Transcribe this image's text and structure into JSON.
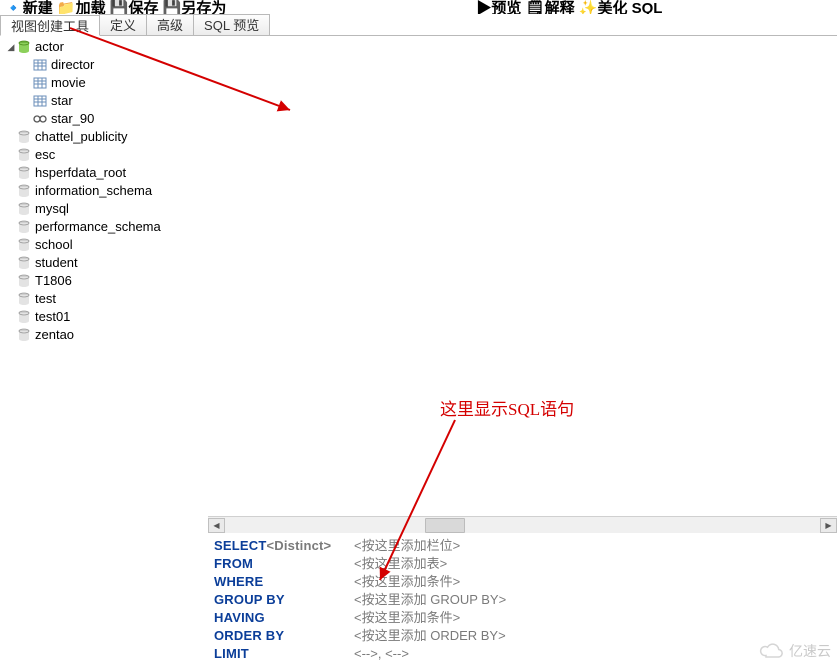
{
  "toolbar": {
    "items": [
      "新建",
      "加载",
      "保存",
      "另存为",
      "预览",
      "解释",
      "美化 SQL"
    ]
  },
  "tabs": [
    {
      "label": "视图创建工具",
      "active": true
    },
    {
      "label": "定义",
      "active": false
    },
    {
      "label": "高级",
      "active": false
    },
    {
      "label": "SQL 预览",
      "active": false
    }
  ],
  "tree": {
    "expanded_db": "actor",
    "actor_children": [
      {
        "label": "director",
        "type": "table"
      },
      {
        "label": "movie",
        "type": "table"
      },
      {
        "label": "star",
        "type": "table"
      },
      {
        "label": "star_90",
        "type": "view"
      }
    ],
    "other_dbs": [
      "chattel_publicity",
      "esc",
      "hsperfdata_root",
      "information_schema",
      "mysql",
      "performance_schema",
      "school",
      "student",
      "T1806",
      "test",
      "test01",
      "zentao"
    ]
  },
  "sql": {
    "select_kw": "SELECT",
    "distinct": "<Distinct>",
    "select_ph": "<按这里添加栏位>",
    "from_kw": "FROM",
    "from_ph": "<按这里添加表>",
    "where_kw": "WHERE",
    "where_ph": "<按这里添加条件>",
    "group_kw": "GROUP BY",
    "group_ph": "<按这里添加 GROUP BY>",
    "having_kw": "HAVING",
    "having_ph": "<按这里添加条件>",
    "order_kw": "ORDER BY",
    "order_ph": "<按这里添加 ORDER BY>",
    "limit_kw": "LIMIT",
    "limit_ph": "<-->, <-->"
  },
  "annotation": {
    "text": "这里显示SQL语句"
  },
  "watermark": {
    "text": "亿速云"
  }
}
